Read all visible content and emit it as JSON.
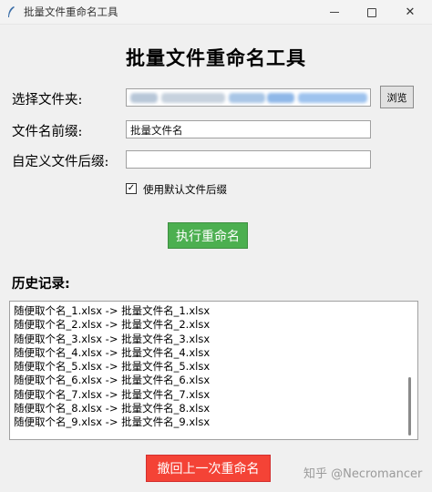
{
  "window": {
    "title": "批量文件重命名工具",
    "icons": {
      "app": "feather-icon",
      "minimize": "minimize-icon",
      "maximize": "maximize-icon",
      "close": "close-icon"
    },
    "close_glyph": "✕"
  },
  "header": {
    "title": "批量文件重命名工具"
  },
  "form": {
    "folder_label": "选择文件夹:",
    "folder_value": "",
    "browse_label": "浏览",
    "prefix_label": "文件名前缀:",
    "prefix_value": "批量文件名",
    "suffix_label": "自定义文件后缀:",
    "suffix_value": "",
    "default_suffix_checked": true,
    "check_glyph": "✓",
    "default_suffix_label": "使用默认文件后缀"
  },
  "actions": {
    "execute_label": "执行重命名",
    "undo_label": "撤回上一次重命名"
  },
  "history": {
    "label": "历史记录:",
    "lines": [
      "随便取个名_1.xlsx -> 批量文件名_1.xlsx",
      "随便取个名_2.xlsx -> 批量文件名_2.xlsx",
      "随便取个名_3.xlsx -> 批量文件名_3.xlsx",
      "随便取个名_4.xlsx -> 批量文件名_4.xlsx",
      "随便取个名_5.xlsx -> 批量文件名_5.xlsx",
      "随便取个名_6.xlsx -> 批量文件名_6.xlsx",
      "随便取个名_7.xlsx -> 批量文件名_7.xlsx",
      "随便取个名_8.xlsx -> 批量文件名_8.xlsx",
      "随便取个名_9.xlsx -> 批量文件名_9.xlsx"
    ]
  },
  "colors": {
    "execute": "#4caf50",
    "undo": "#f44336"
  },
  "watermark": "知乎 @Necromancer"
}
